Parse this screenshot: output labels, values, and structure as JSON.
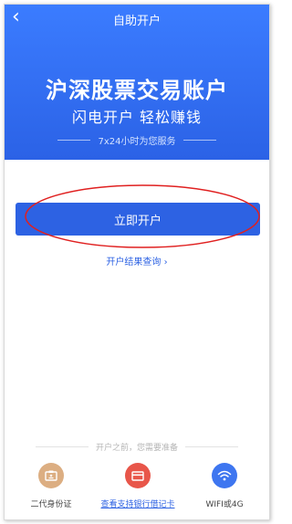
{
  "nav": {
    "back_icon": "chevron-left-icon",
    "title": "自助开户"
  },
  "hero": {
    "headline": "沪深股票交易账户",
    "subline": "闪电开户  轻松赚钱",
    "service": "7x24小时为您服务"
  },
  "actions": {
    "open_label": "立即开户",
    "query_label": "开户结果查询 ›"
  },
  "requirements": {
    "title": "开户之前，您需要准备",
    "items": [
      {
        "label": "二代身份证",
        "icon": "id-card-icon",
        "color": "#dcae82"
      },
      {
        "label": "查看支持银行借记卡",
        "icon": "bank-card-icon",
        "color": "#e8564a"
      },
      {
        "label": "WIFI或4G",
        "icon": "wifi-icon",
        "color": "#3e76f0"
      }
    ]
  },
  "colors": {
    "brand": "#2d62e3",
    "annotation": "#e02020"
  }
}
